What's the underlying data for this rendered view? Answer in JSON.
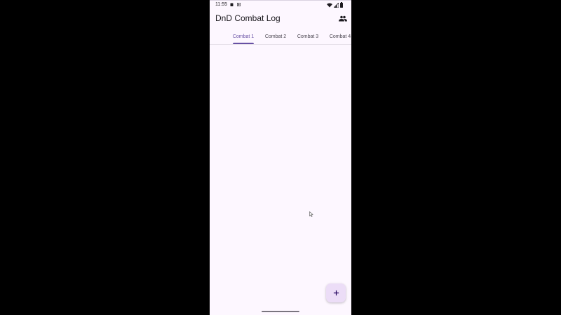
{
  "status_bar": {
    "time": "11:55",
    "icons": [
      "clipboard-icon",
      "download-icon",
      "wifi-icon",
      "signal-icon",
      "battery-icon"
    ]
  },
  "app_bar": {
    "title": "DnD Combat Log",
    "action_icon": "people-icon"
  },
  "tabs": [
    {
      "label": "Combat 1",
      "selected": true
    },
    {
      "label": "Combat 2",
      "selected": false
    },
    {
      "label": "Combat 3",
      "selected": false
    },
    {
      "label": "Combat 4",
      "selected": false
    }
  ],
  "fab": {
    "label": "+",
    "icon": "add-icon"
  },
  "colors": {
    "background": "#fdf7ff",
    "accent": "#6750a4",
    "fab": "#ecddf7"
  }
}
